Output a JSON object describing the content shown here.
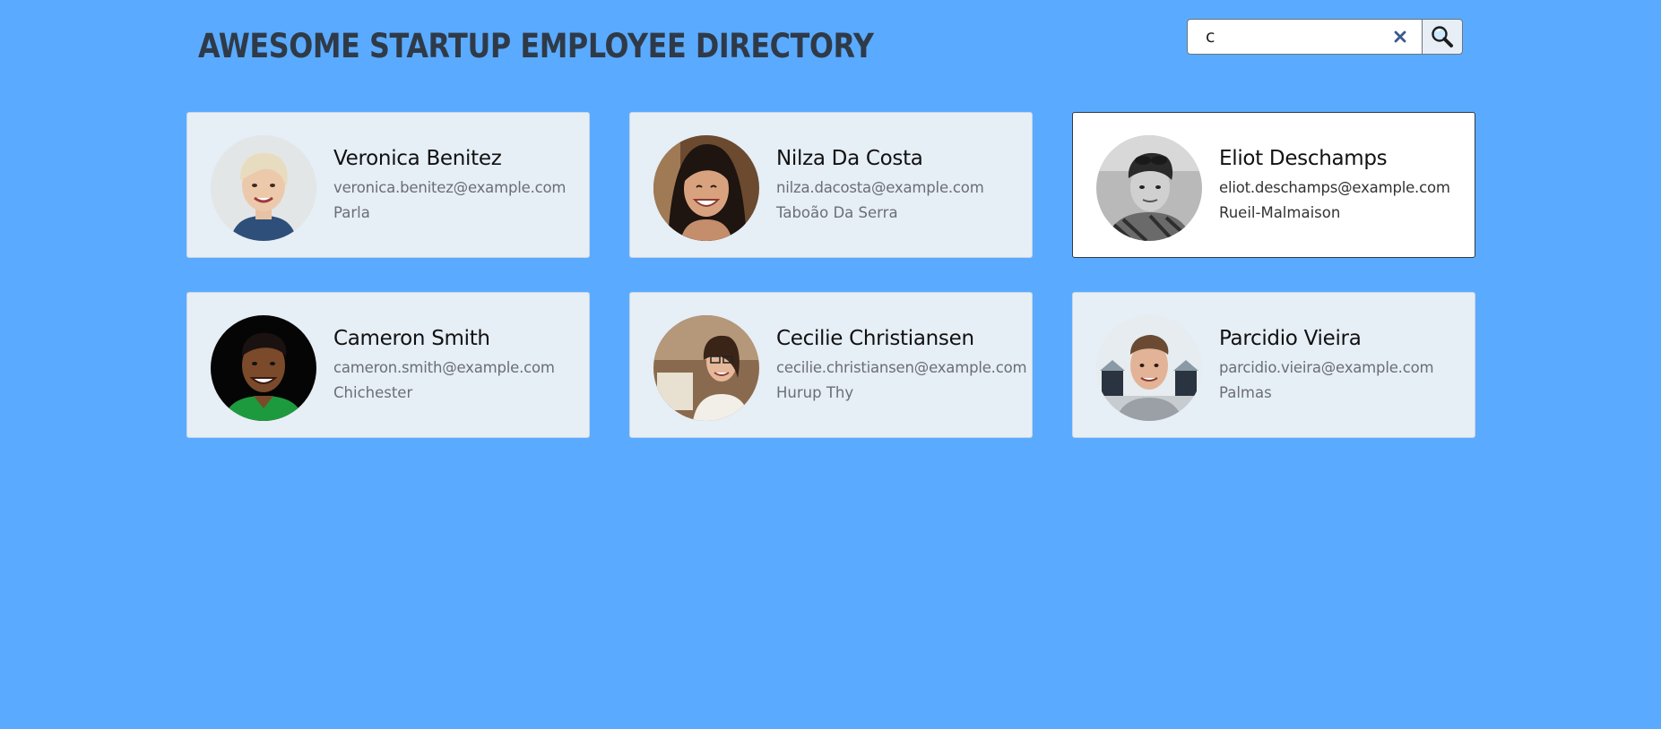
{
  "header": {
    "title": "AWESOME STARTUP EMPLOYEE DIRECTORY"
  },
  "search": {
    "value": "c",
    "clear_icon": "close-icon",
    "button_icon": "magnifier-icon"
  },
  "colors": {
    "background": "#5aabff",
    "card": "#e6eef6",
    "card_active": "#ffffff"
  },
  "employees": [
    {
      "name": "Veronica Benitez",
      "email": "veronica.benitez@example.com",
      "city": "Parla",
      "active": false
    },
    {
      "name": "Nilza Da Costa",
      "email": "nilza.dacosta@example.com",
      "city": "Taboão Da Serra",
      "active": false
    },
    {
      "name": "Eliot Deschamps",
      "email": "eliot.deschamps@example.com",
      "city": "Rueil-Malmaison",
      "active": true
    },
    {
      "name": "Cameron Smith",
      "email": "cameron.smith@example.com",
      "city": "Chichester",
      "active": false
    },
    {
      "name": "Cecilie Christiansen",
      "email": "cecilie.christiansen@example.com",
      "city": "Hurup Thy",
      "active": false
    },
    {
      "name": "Parcidio Vieira",
      "email": "parcidio.vieira@example.com",
      "city": "Palmas",
      "active": false
    }
  ]
}
